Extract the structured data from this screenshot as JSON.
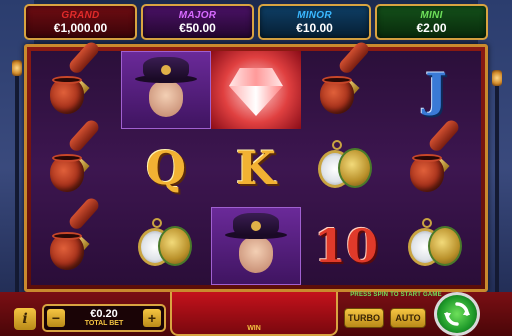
{
  "jackpots": [
    {
      "label": "GRAND",
      "value": "€1,000.00",
      "color": "#e02a2a"
    },
    {
      "label": "MAJOR",
      "value": "€50.00",
      "color": "#d86bff"
    },
    {
      "label": "MINOR",
      "value": "€10.00",
      "color": "#3ab8ff"
    },
    {
      "label": "MINI",
      "value": "€2.00",
      "color": "#6ee05a"
    }
  ],
  "reels": {
    "symbols": [
      [
        "pipe",
        "lady",
        "diamond",
        "pipe",
        "J"
      ],
      [
        "pipe",
        "Q",
        "K",
        "watch",
        "pipe"
      ],
      [
        "pipe",
        "watch",
        "lady",
        "10",
        "watch"
      ]
    ]
  },
  "controls": {
    "info_label": "i",
    "bet_minus": "−",
    "bet_plus": "+",
    "bet_value": "€0.20",
    "bet_label": "TOTAL BET",
    "win_label": "WIN",
    "hint": "PRESS SPIN TO START GAME",
    "turbo_label": "TURBO",
    "auto_label": "AUTO"
  },
  "icons": {
    "spin": "refresh-arrows-icon",
    "pipe": "pipe-icon",
    "watch": "pocket-watch-icon",
    "lady": "lady-portrait-icon",
    "diamond": "diamond-icon"
  }
}
